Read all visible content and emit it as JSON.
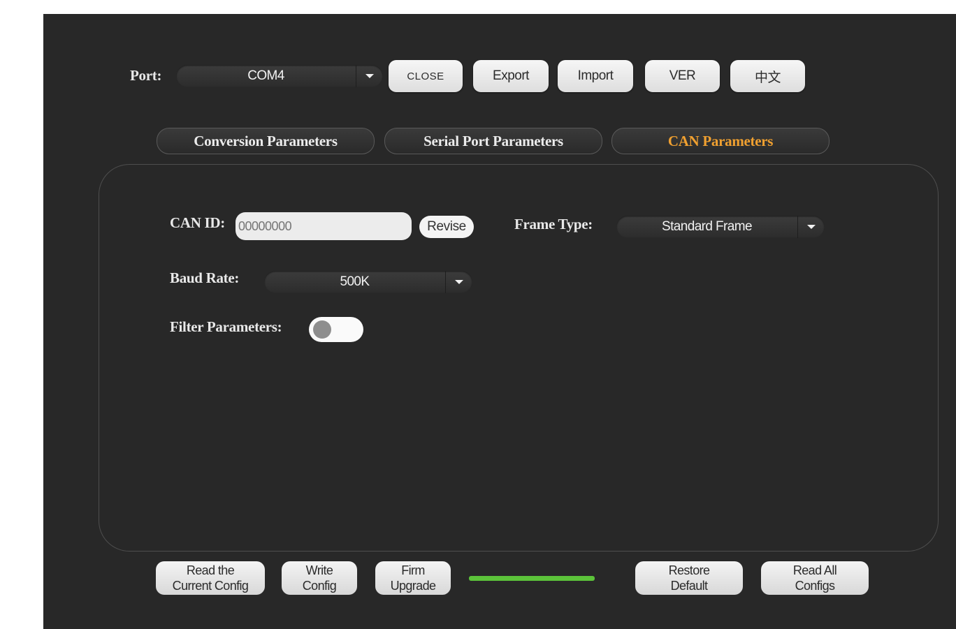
{
  "toolbar": {
    "port_label": "Port:",
    "port_value": "COM4",
    "close_label": "CLOSE",
    "export_label": "Export",
    "import_label": "Import",
    "ver_label": "VER",
    "lang_label": "中文"
  },
  "tabs": [
    {
      "label": "Conversion Parameters",
      "active": false
    },
    {
      "label": "Serial Port Parameters",
      "active": false
    },
    {
      "label": "CAN Parameters",
      "active": true
    }
  ],
  "can": {
    "can_id_label": "CAN ID:",
    "can_id_placeholder": "00000000",
    "revise_label": "Revise",
    "frame_type_label": "Frame Type:",
    "frame_type_value": "Standard Frame",
    "baud_rate_label": "Baud Rate:",
    "baud_rate_value": "500K",
    "filter_label": "Filter Parameters:",
    "filter_enabled": false
  },
  "footer": {
    "read_current": [
      "Read the",
      "Current Config"
    ],
    "write_config": [
      "Write",
      "Config"
    ],
    "firm_upgrade": [
      "Firm",
      "Upgrade"
    ],
    "progress": 1.0,
    "restore_default": [
      "Restore",
      "Default"
    ],
    "read_all": [
      "Read All",
      "Configs"
    ]
  },
  "colors": {
    "background": "#282828",
    "active_tab": "#f0a030",
    "progress": "#5cc33a"
  }
}
